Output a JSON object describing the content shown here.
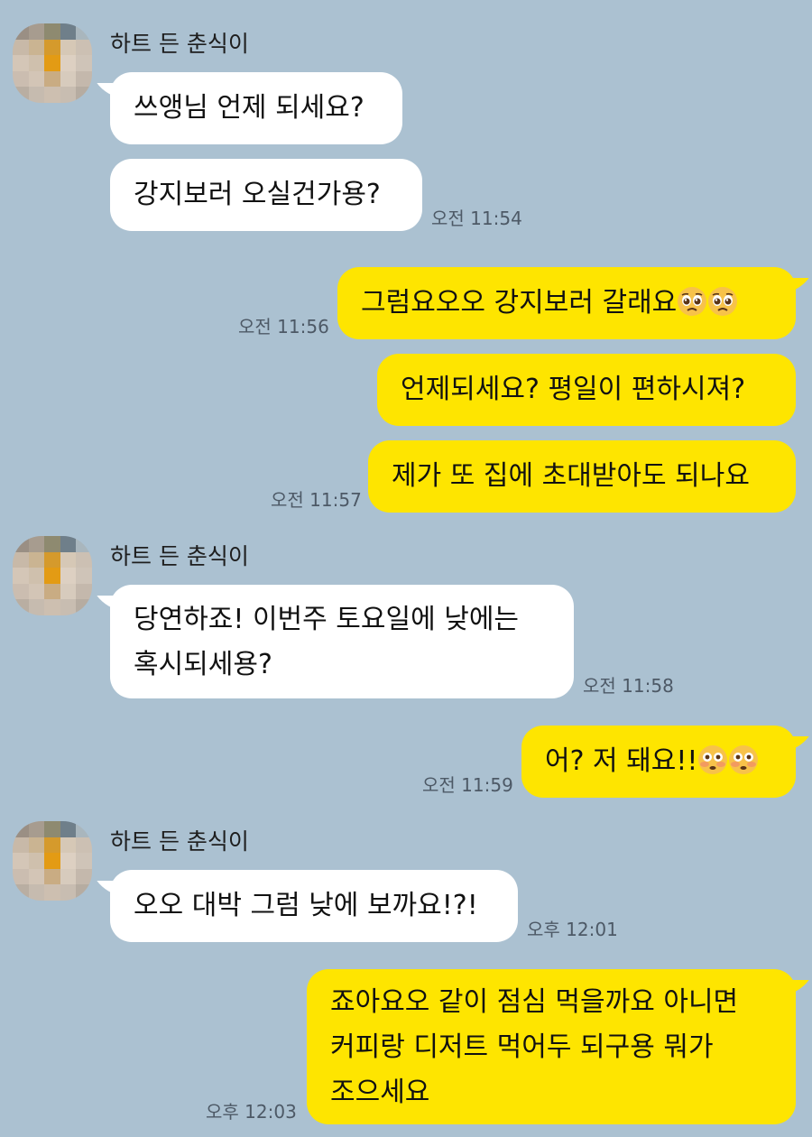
{
  "chat": {
    "sender_name": "하트 든 춘식이",
    "messages": {
      "m1": "쓰앵님 언제 되세요?",
      "m2": "강지보러 오실건가용?",
      "m3": "그럼요오오 강지보러 갈래요",
      "m4": "언제되세요? 평일이 편하시져?",
      "m5": "제가 또 집에 초대받아도 되나요",
      "m6_line1": "당연하죠! 이번주 토요일에 낮에는",
      "m6_line2": "혹시되세용?",
      "m7": "어? 저 돼요!!",
      "m8": "오오 대박 그럼 낮에 보까요!?!",
      "m9_line1": "죠아요오 같이 점심 먹을까요 아니면",
      "m9_line2": "커피랑 디저트 먹어두 되구용 뭐가",
      "m9_line3": "조으세요"
    },
    "times": {
      "t1": "오전 11:54",
      "t2": "오전 11:56",
      "t3": "오전 11:57",
      "t4": "오전 11:58",
      "t5": "오전 11:59",
      "t6": "오후 12:01",
      "t7": "오후 12:03"
    },
    "emoji_names": {
      "pleading": "pleading-face-emoji",
      "flushed": "flushed-face-emoji"
    }
  },
  "colors": {
    "background": "#abc1d1",
    "incoming_bubble": "#ffffff",
    "outgoing_bubble": "#fee500",
    "timestamp": "#4d5966"
  }
}
